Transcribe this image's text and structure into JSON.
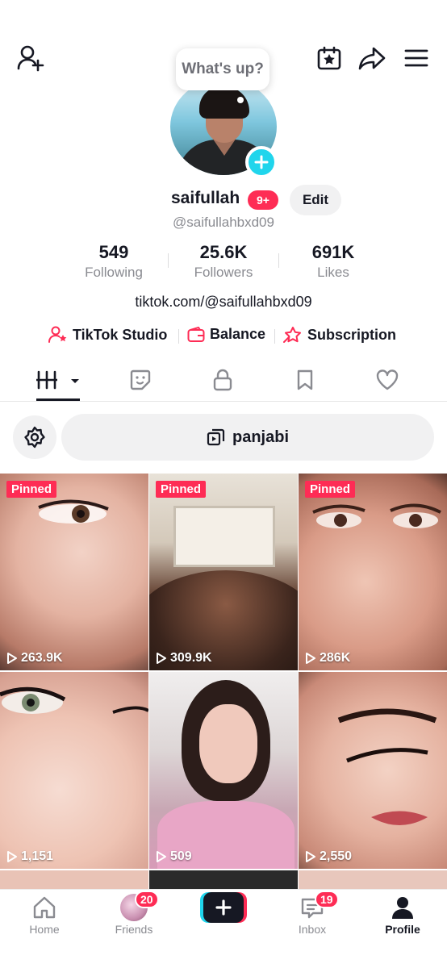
{
  "top_bar": {
    "icons": [
      "add-friend-icon",
      "calendar-star-icon",
      "share-icon",
      "menu-icon"
    ]
  },
  "profile": {
    "status_bubble": "What's up?",
    "username": "saifullah",
    "notification_badge": "9+",
    "edit_label": "Edit",
    "handle": "@saifullahbxd09",
    "stats": [
      {
        "value": "549",
        "label": "Following"
      },
      {
        "value": "25.6K",
        "label": "Followers"
      },
      {
        "value": "691K",
        "label": "Likes"
      }
    ],
    "link": "tiktok.com/@saifullahbxd09",
    "quick_links": [
      {
        "label": "TikTok Studio",
        "icon": "studio-person-icon"
      },
      {
        "label": "Balance",
        "icon": "wallet-icon"
      },
      {
        "label": "Subscription",
        "icon": "subscription-star-icon"
      }
    ]
  },
  "tabs": [
    "videos-tab",
    "reposts-tab",
    "private-tab",
    "favorites-tab",
    "liked-tab"
  ],
  "filter": {
    "playlist_label": "panjabi"
  },
  "videos": [
    {
      "pinned": "Pinned",
      "views": "263.9K"
    },
    {
      "pinned": "Pinned",
      "views": "309.9K"
    },
    {
      "pinned": "Pinned",
      "views": "286K"
    },
    {
      "pinned": "",
      "views": "1,151"
    },
    {
      "pinned": "",
      "views": "509"
    },
    {
      "pinned": "",
      "views": "2,550"
    }
  ],
  "bottom_nav": {
    "items": [
      {
        "label": "Home"
      },
      {
        "label": "Friends",
        "badge": "20"
      },
      {
        "label": "",
        "badge": ""
      },
      {
        "label": "Inbox",
        "badge": "19"
      },
      {
        "label": "Profile"
      }
    ]
  },
  "colors": {
    "accent": "#fe2c55",
    "cyan": "#20d5ec",
    "text": "#161823",
    "muted": "#8a8b91"
  }
}
